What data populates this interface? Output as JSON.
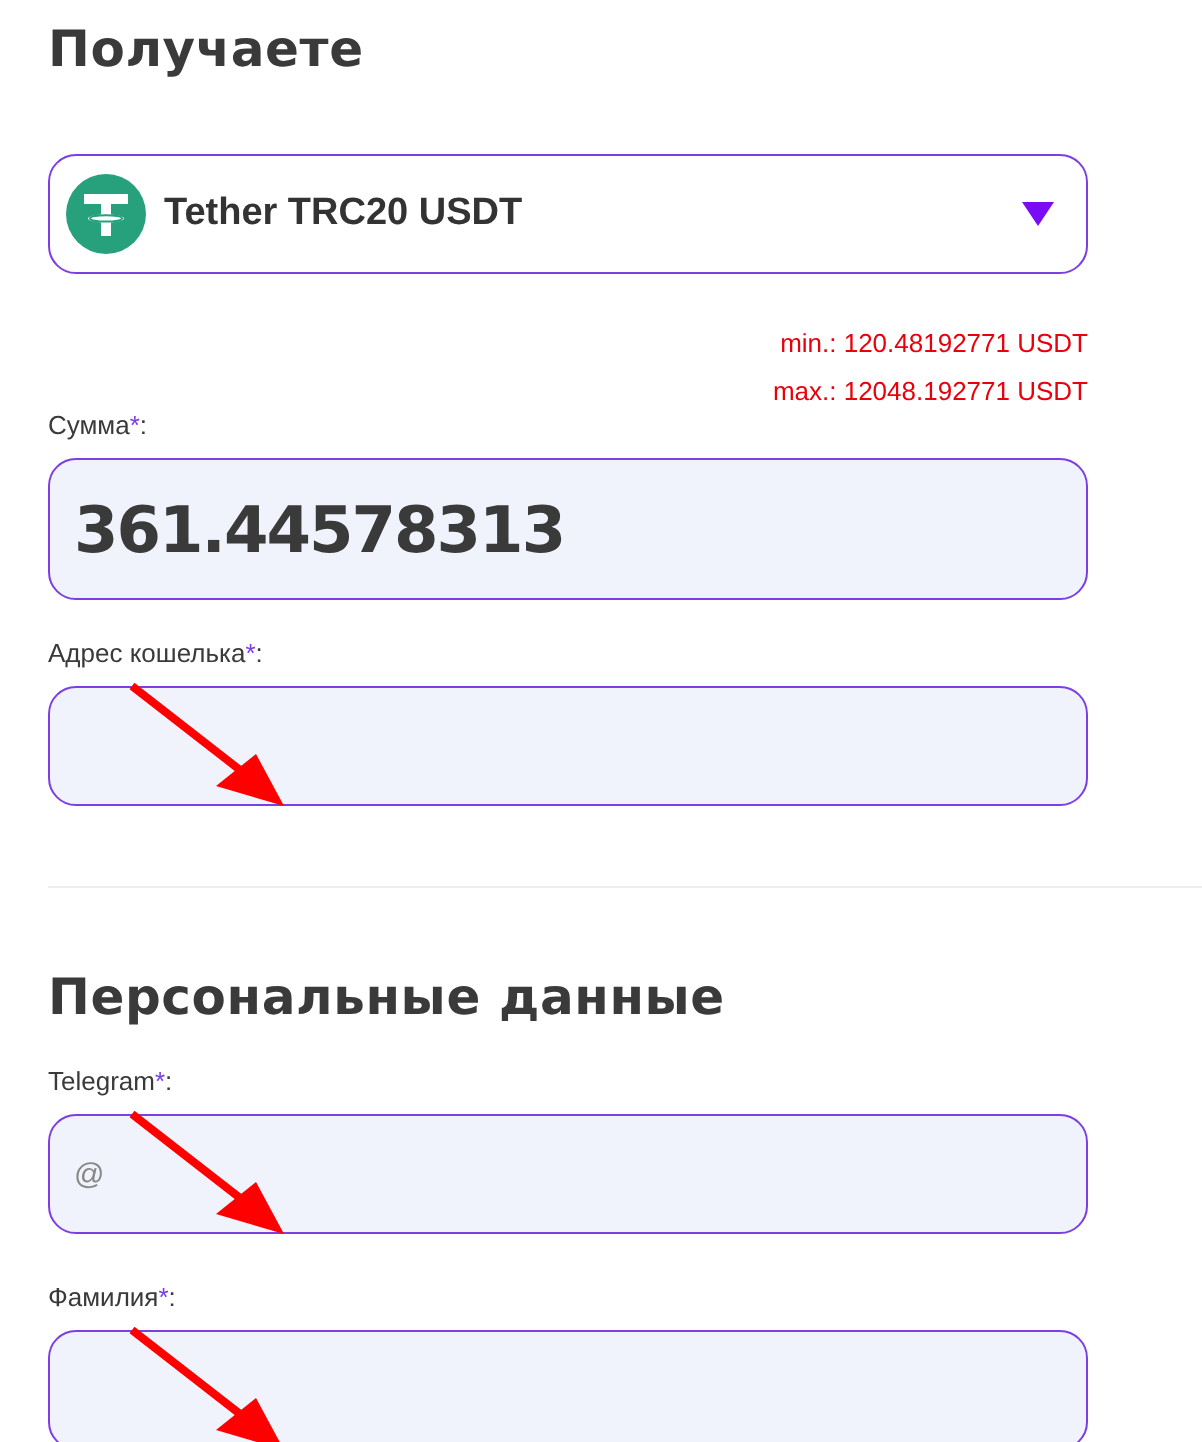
{
  "receive_section": {
    "title": "Получаете",
    "currency_select": {
      "value": "Tether TRC20 USDT"
    },
    "limits": [
      "min.: 120.48192771 USDT",
      "max.: 12048.192771 USDT"
    ],
    "fields": [
      {
        "kind": "amount",
        "label": "Сумма",
        "required_mark": "*",
        "label_end": ":",
        "value": "361.44578313",
        "arrow": false
      },
      {
        "kind": "text",
        "label": "Адрес кошелька",
        "required_mark": "*",
        "label_end": ":",
        "arrow": true
      }
    ]
  },
  "personal_section": {
    "title": "Персональные данные",
    "fields": [
      {
        "kind": "text",
        "label": "Telegram",
        "required_mark": "*",
        "label_end": ":",
        "placeholder": "@",
        "arrow": true
      },
      {
        "kind": "text",
        "label": "Фамилия",
        "required_mark": "*",
        "label_end": ":",
        "arrow": true
      }
    ]
  }
}
